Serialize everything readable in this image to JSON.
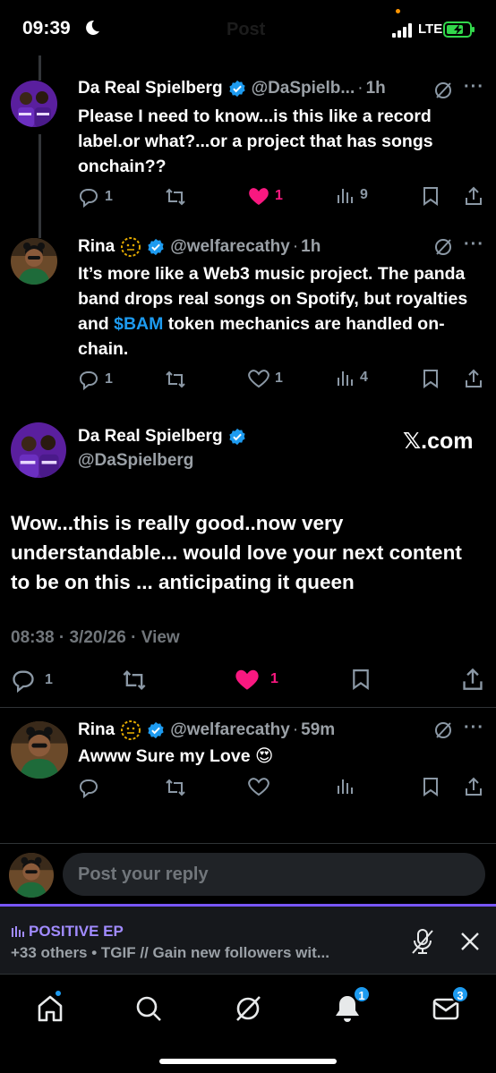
{
  "status_bar": {
    "time": "09:39",
    "ghost_title": "Post",
    "network": "LTE"
  },
  "tweets": [
    {
      "name": "Da Real Spielberg",
      "handle": "@DaSpielb...",
      "time": "1h",
      "text": "Please I need to know...is this like a record label.or what?...or a project that has songs onchain??",
      "replies": "1",
      "likes": "1",
      "views": "9"
    },
    {
      "name": "Rina",
      "handle": "@welfarecathy",
      "time": "1h",
      "text_before": "It’s more like a Web3 music project. The panda band drops real songs on Spotify, but royalties and ",
      "cashtag": "$BAM",
      "text_after": " token mechanics are handled on-chain.",
      "replies": "1",
      "likes": "1",
      "views": "4"
    }
  ],
  "main_tweet": {
    "name": "Da Real Spielberg",
    "handle": "@DaSpielberg",
    "watermark": "𝕏.com",
    "text": "Wow...this is really good..now very understandable... would love your next content to be on this ... anticipating it queen",
    "meta": "08:38 · 3/20/26 · View",
    "replies": "1",
    "likes": "1"
  },
  "reply_tweet": {
    "name": "Rina",
    "handle": "@welfarecathy",
    "time": "59m",
    "text": "Awww Sure my Love 😍"
  },
  "reply_bar": {
    "placeholder": "Post your reply"
  },
  "space": {
    "title": "POSITIVE EP",
    "subtitle": "+33 others • TGIF // Gain new followers wit..."
  },
  "nav": {
    "notifications_badge": "1",
    "messages_badge": "3"
  },
  "colors": {
    "accent": "#1d9bf0",
    "like": "#f91880",
    "space": "#7856ff"
  }
}
